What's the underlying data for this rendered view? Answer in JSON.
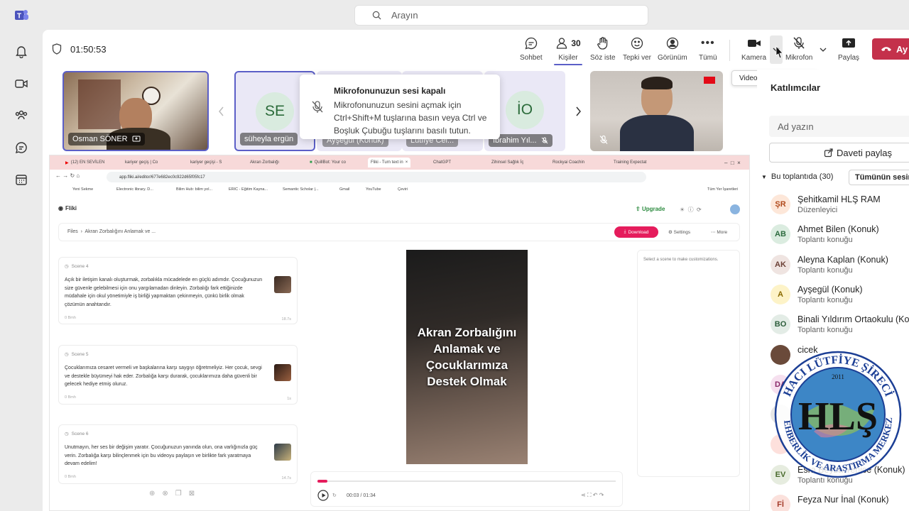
{
  "search": {
    "placeholder": "Arayın"
  },
  "meeting": {
    "timer": "01:50:53"
  },
  "toolbar": {
    "chat": "Sohbet",
    "people": "Kişiler",
    "people_count": "30",
    "raise_hand": "Söz iste",
    "react": "Tepki ver",
    "view": "Görünüm",
    "more": "Tümü",
    "camera": "Kamera",
    "mic": "Mikrofon",
    "share": "Paylaş",
    "leave": "Ay"
  },
  "tooltip": "Video seçeneklerini aç",
  "toast": {
    "title": "Mikrofonunuzun sesi kapalı",
    "body": "Mikrofonunuzun sesini açmak için Ctrl+Shift+M tuşlarına basın veya Ctrl ve Boşluk Çubuğu tuşlarını basılı tutun."
  },
  "tiles": [
    {
      "name": "Osman SÖNER"
    },
    {
      "initials": "SE",
      "name": "süheyla ergün"
    },
    {
      "name": "Ayşegül (Konuk)"
    },
    {
      "name": "Lütfiye Cel..."
    },
    {
      "initials": "İO",
      "name": "İbrahim Yıl..."
    }
  ],
  "browser": {
    "tabs": [
      "(12) EN SEVİLEN",
      "kariyer geçiş | Co",
      "kariyer geçişi - S",
      "Akran Zorbalığı",
      "QuillBot: Your co",
      "Fliki - Turn text in",
      "ChatGPT",
      "Zihinsel Sağlık İç",
      "Rockyai Coachin",
      "Training Expectat"
    ],
    "url": "app.fliki.ai/editor/677e682ec0c922d65f05fc17",
    "bookmarks": [
      "Yeni Sekme",
      "Electronic library. D...",
      "Bilim Hub: bilim yol...",
      "ERIC - Eğitim Kayna...",
      "Semantic Scholar |...",
      "Gmail",
      "YouTube",
      "Çeviri",
      "Tüm Yer İşaretleri"
    ]
  },
  "fliki": {
    "logo": "Fliki",
    "upgrade": "Upgrade",
    "breadcrumb_root": "Files",
    "breadcrumb_current": "Akran Zorbalığını Anlamak ve ...",
    "download": "Download",
    "settings": "Settings",
    "more": "More",
    "side_hint": "Select a scene to make customizations.",
    "video_title": "Akran Zorbalığını Anlamak ve Çocuklarımıza Destek Olmak",
    "time": "00:03 / 01:34",
    "scenes": [
      {
        "label": "Scene 4",
        "text": "Açık bir iletişim kanalı oluşturmak, zorbalıkla mücadelede en güçlü adımdır. Çocuğunuzun size güvenle gelebilmesi için onu yargılamadan dinleyin. Zorbalığı fark ettiğinizde müdahale için okul yönetimiyle iş birliği yapmaktan çekinmeyin, çünkü birlik olmak çözümün anahtarıdır.",
        "meta": "0 Bmh",
        "meta2": "18.7s"
      },
      {
        "label": "Scene 5",
        "text": "Çocuklarımıza cesaret vermeli ve başkalarına karşı saygıyı öğretmeliyiz. Her çocuk, sevgi ve destekle büyümeyi hak eder. Zorbalığa karşı durarak, çocuklarımıza daha güvenli bir gelecek hediye etmiş oluruz.",
        "meta": "0 Bmh",
        "meta2": "1s"
      },
      {
        "label": "Scene 6",
        "text": "Unutmayın, her ses bir değişim yaratır. Çocuğunuzun yanında olun, ona varlığınızla güç verin. Zorbalığa karşı bilinçlenmek için bu videoyu paylaşın ve birlikte fark yaratmaya devam edelim!",
        "meta": "0 Bmh",
        "meta2": "14.7s"
      }
    ]
  },
  "panel": {
    "title": "Katılımcılar",
    "search_placeholder": "Ad yazın",
    "invite": "Daveti paylaş",
    "section": "Bu toplantıda (30)",
    "mute_all": "Tümünün sesini",
    "people": [
      {
        "initials": "ŞR",
        "name": "Şehitkamil HLŞ RAM",
        "role": "Düzenleyici",
        "color": "#fde7d9",
        "fg": "#b04a1c"
      },
      {
        "initials": "AB",
        "name": "Ahmet Bilen (Konuk)",
        "role": "Toplantı konuğu",
        "color": "#dbece0",
        "fg": "#2d6b3f"
      },
      {
        "initials": "AK",
        "name": "Aleyna Kaplan (Konuk)",
        "role": "Toplantı konuğu",
        "color": "#efe4e1",
        "fg": "#6b3f35"
      },
      {
        "initials": "A",
        "name": "Ayşegül (Konuk)",
        "role": "Toplantı konuğu",
        "color": "#fdf3c8",
        "fg": "#8a6a00"
      },
      {
        "initials": "BO",
        "name": "Binali Yıldırım Ortaokulu (Kon",
        "role": "Toplantı konuğu",
        "color": "#e3ece6",
        "fg": "#2d5e3c"
      },
      {
        "initials": "",
        "name": "cicek",
        "role": "",
        "color": "#6a4a3a",
        "fg": "#fff"
      },
      {
        "initials": "DA",
        "name": "",
        "role": "",
        "color": "#f6e0ef",
        "fg": "#8a2b6a"
      },
      {
        "initials": "",
        "name": "",
        "role": "",
        "color": "#e6e6e6",
        "fg": "#555"
      },
      {
        "initials": "",
        "name": "",
        "role": "",
        "color": "#fde0dc",
        "fg": "#a33"
      },
      {
        "initials": "EV",
        "name": "Esra Beyza Yenice (Konuk)",
        "role": "Toplantı konuğu",
        "color": "#e6ecdf",
        "fg": "#4a6b2d"
      },
      {
        "initials": "Fİ",
        "name": "Feyza Nur İnal (Konuk)",
        "role": "",
        "color": "#fbe1dc",
        "fg": "#a43c2b"
      }
    ]
  },
  "watermark": {
    "top": "HACI LÜTFİYE ŞİRECİ",
    "mono": "HLŞ",
    "year": "2011",
    "bottom": "REHBERLİK VE ARAŞTIRMA MERKEZİ"
  }
}
